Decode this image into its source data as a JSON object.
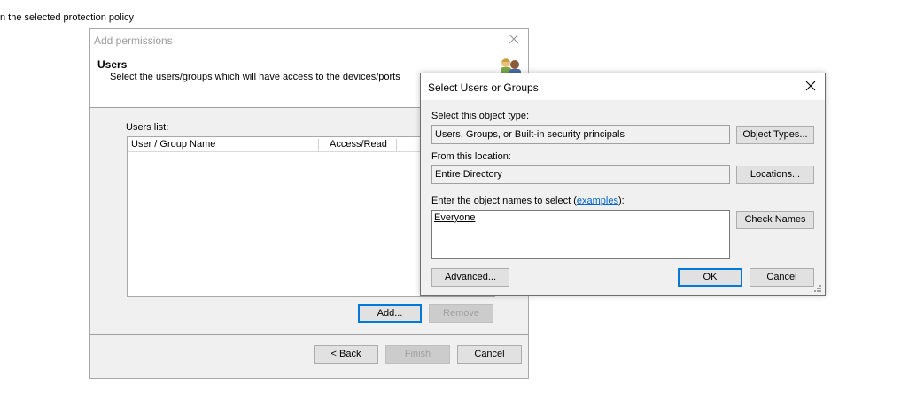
{
  "background": {
    "partial_text": "n the selected protection policy"
  },
  "add_permissions": {
    "title": "Add permissions",
    "heading": "Users",
    "subheading": "Select the users/groups which will have access to the devices/ports",
    "users_list_label": "Users list:",
    "columns": [
      "User / Group Name",
      "Access/Read"
    ],
    "add_label": "Add...",
    "remove_label": "Remove",
    "back_label": "< Back",
    "finish_label": "Finish",
    "cancel_label": "Cancel"
  },
  "select_users": {
    "title": "Select Users or Groups",
    "object_type_label": "Select this object type:",
    "object_type_value": "Users, Groups, or Built-in security principals",
    "object_types_button": "Object Types...",
    "location_label": "From this location:",
    "location_value": "Entire Directory",
    "locations_button": "Locations...",
    "names_label_prefix": "Enter the object names to select (",
    "names_label_link": "examples",
    "names_label_suffix": "):",
    "names_value": "Everyone",
    "check_names_button": "Check Names",
    "advanced_button": "Advanced...",
    "ok_button": "OK",
    "cancel_button": "Cancel"
  },
  "colors": {
    "accent": "#0078d7",
    "link": "#0066cc"
  }
}
